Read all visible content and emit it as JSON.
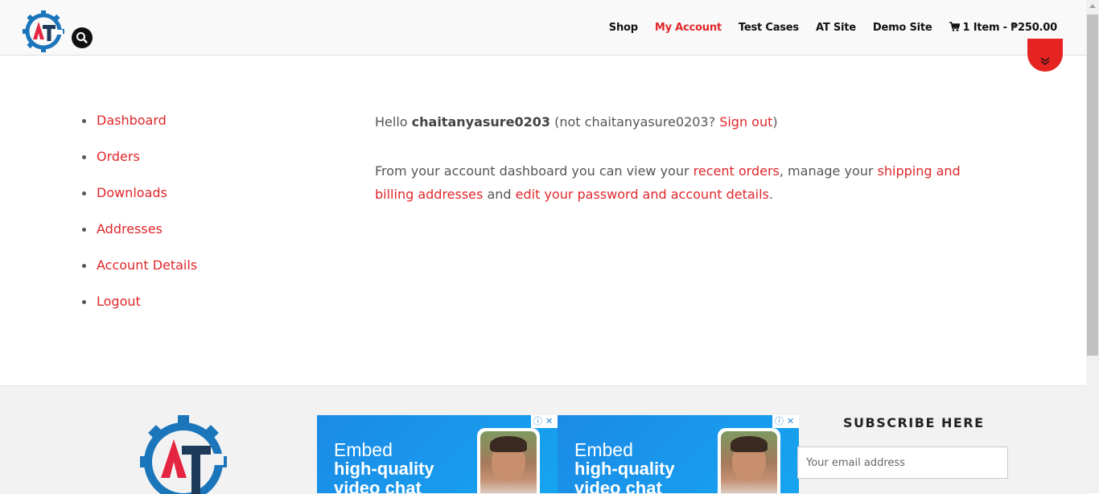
{
  "header": {
    "nav": [
      {
        "label": "Shop",
        "active": false
      },
      {
        "label": "My Account",
        "active": true
      },
      {
        "label": "Test Cases",
        "active": false
      },
      {
        "label": "AT Site",
        "active": false
      },
      {
        "label": "Demo Site",
        "active": false
      }
    ],
    "cart": {
      "label": "1 Item - ₱250.00",
      "icon": "cart-icon"
    },
    "search_icon": "search-icon",
    "logo_text": "AT"
  },
  "account_nav": [
    {
      "label": "Dashboard"
    },
    {
      "label": "Orders"
    },
    {
      "label": "Downloads"
    },
    {
      "label": "Addresses"
    },
    {
      "label": "Account Details"
    },
    {
      "label": "Logout"
    }
  ],
  "dashboard": {
    "hello": "Hello ",
    "username": "chaitanyasure0203",
    "not_prefix": " (not chaitanyasure0203? ",
    "sign_out": "Sign out",
    "not_suffix": ")",
    "intro": "From your account dashboard you can view your ",
    "recent_orders": "recent orders",
    "mid": ", manage your ",
    "addresses_link": "shipping and billing addresses",
    "and": " and ",
    "password_link": "edit your password and account details",
    "end": "."
  },
  "footer": {
    "ads": [
      {
        "line1": "Embed",
        "line2": "high-quality",
        "line3": "video chat"
      },
      {
        "line1": "Embed",
        "line2": "high-quality",
        "line3": "video chat"
      }
    ],
    "subscribe_title": "SUBSCRIBE HERE",
    "email_placeholder": "Your email address"
  },
  "colors": {
    "accent": "#e0262b",
    "logo_blue": "#1b75bb",
    "logo_red": "#e52441",
    "logo_dark": "#1d3a5a"
  }
}
